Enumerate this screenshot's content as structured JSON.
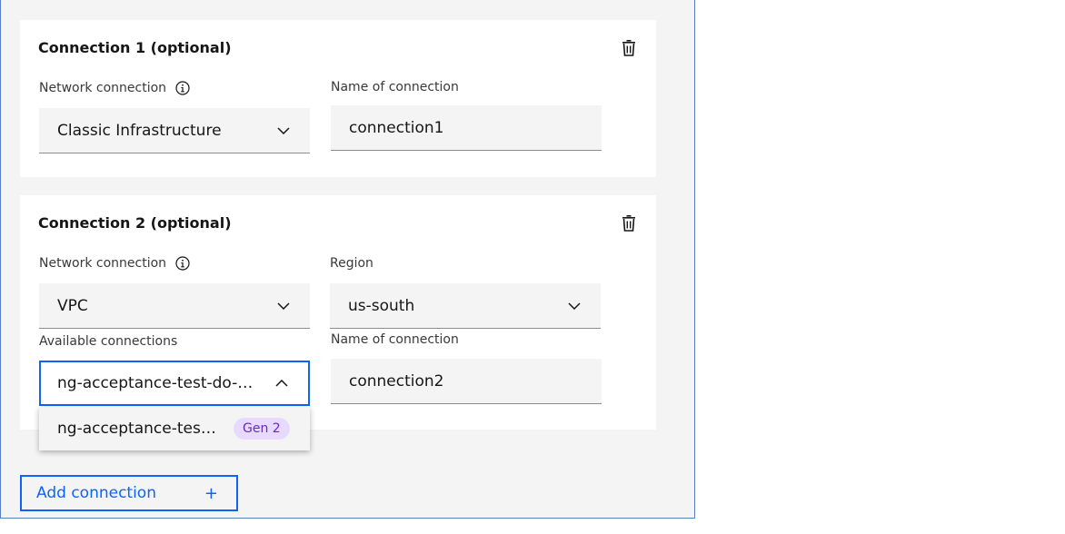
{
  "connections": [
    {
      "title": "Connection 1 (optional)",
      "network_label": "Network connection",
      "network_value": "Classic Infrastructure",
      "name_label": "Name of connection",
      "name_value": "connection1"
    },
    {
      "title": "Connection 2 (optional)",
      "network_label": "Network connection",
      "network_value": "VPC",
      "region_label": "Region",
      "region_value": "us-south",
      "available_label": "Available connections",
      "available_value": "ng-acceptance-test-do-n...",
      "name_label": "Name of connection",
      "name_value": "connection2",
      "dropdown_option": "ng-acceptance-test-...",
      "dropdown_tag": "Gen 2"
    }
  ],
  "add_button_label": "Add connection",
  "add_button_icon": "+",
  "icons": {
    "delete": "trash-icon",
    "info": "info-icon",
    "chevron": "chevron-down-icon"
  },
  "colors": {
    "accent": "#0f62fe",
    "tag_bg": "#e8daff",
    "tag_text": "#6929c4"
  }
}
